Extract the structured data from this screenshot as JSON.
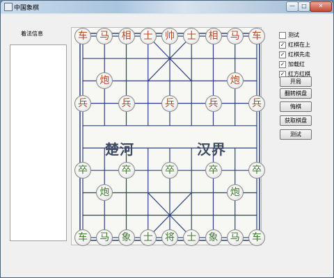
{
  "window": {
    "title": "中国象棋",
    "min_label": "—",
    "max_label": "□",
    "close_label": "✕"
  },
  "panel": {
    "move_label": "着法信息"
  },
  "board": {
    "river_left": "楚河",
    "river_right": "汉界",
    "pieces": [
      {
        "text": "车",
        "side": "red",
        "file": 0,
        "rank": 0
      },
      {
        "text": "马",
        "side": "red",
        "file": 1,
        "rank": 0
      },
      {
        "text": "相",
        "side": "red",
        "file": 2,
        "rank": 0
      },
      {
        "text": "士",
        "side": "red",
        "file": 3,
        "rank": 0
      },
      {
        "text": "帅",
        "side": "red",
        "file": 4,
        "rank": 0
      },
      {
        "text": "士",
        "side": "red",
        "file": 5,
        "rank": 0
      },
      {
        "text": "相",
        "side": "red",
        "file": 6,
        "rank": 0
      },
      {
        "text": "马",
        "side": "red",
        "file": 7,
        "rank": 0
      },
      {
        "text": "车",
        "side": "red",
        "file": 8,
        "rank": 0
      },
      {
        "text": "炮",
        "side": "red",
        "file": 1,
        "rank": 2
      },
      {
        "text": "炮",
        "side": "red",
        "file": 7,
        "rank": 2
      },
      {
        "text": "兵",
        "side": "red",
        "file": 0,
        "rank": 3
      },
      {
        "text": "兵",
        "side": "red",
        "file": 2,
        "rank": 3
      },
      {
        "text": "兵",
        "side": "red",
        "file": 4,
        "rank": 3
      },
      {
        "text": "兵",
        "side": "red",
        "file": 6,
        "rank": 3
      },
      {
        "text": "兵",
        "side": "red",
        "file": 8,
        "rank": 3
      },
      {
        "text": "卒",
        "side": "black",
        "file": 0,
        "rank": 6
      },
      {
        "text": "卒",
        "side": "black",
        "file": 2,
        "rank": 6
      },
      {
        "text": "卒",
        "side": "black",
        "file": 4,
        "rank": 6
      },
      {
        "text": "卒",
        "side": "black",
        "file": 6,
        "rank": 6
      },
      {
        "text": "卒",
        "side": "black",
        "file": 8,
        "rank": 6
      },
      {
        "text": "炮",
        "side": "black",
        "file": 1,
        "rank": 7
      },
      {
        "text": "炮",
        "side": "black",
        "file": 7,
        "rank": 7
      },
      {
        "text": "车",
        "side": "black",
        "file": 0,
        "rank": 9
      },
      {
        "text": "马",
        "side": "black",
        "file": 1,
        "rank": 9
      },
      {
        "text": "象",
        "side": "black",
        "file": 2,
        "rank": 9
      },
      {
        "text": "士",
        "side": "black",
        "file": 3,
        "rank": 9
      },
      {
        "text": "将",
        "side": "black",
        "file": 4,
        "rank": 9
      },
      {
        "text": "士",
        "side": "black",
        "file": 5,
        "rank": 9
      },
      {
        "text": "象",
        "side": "black",
        "file": 6,
        "rank": 9
      },
      {
        "text": "马",
        "side": "black",
        "file": 7,
        "rank": 9
      },
      {
        "text": "车",
        "side": "black",
        "file": 8,
        "rank": 9
      }
    ]
  },
  "options": [
    {
      "label": "测试",
      "checked": false
    },
    {
      "label": "红棋在上",
      "checked": true
    },
    {
      "label": "红棋先走",
      "checked": true
    },
    {
      "label": "加载红",
      "checked": true
    },
    {
      "label": "红方红棋",
      "checked": true
    }
  ],
  "buttons": [
    "开局",
    "翻转棋盘",
    "悔棋",
    "获取棋盘",
    "测试"
  ],
  "colors": {
    "red_piece": "#b3471f",
    "black_piece": "#3b7a2a",
    "grid_line": "#2c3f7a"
  }
}
